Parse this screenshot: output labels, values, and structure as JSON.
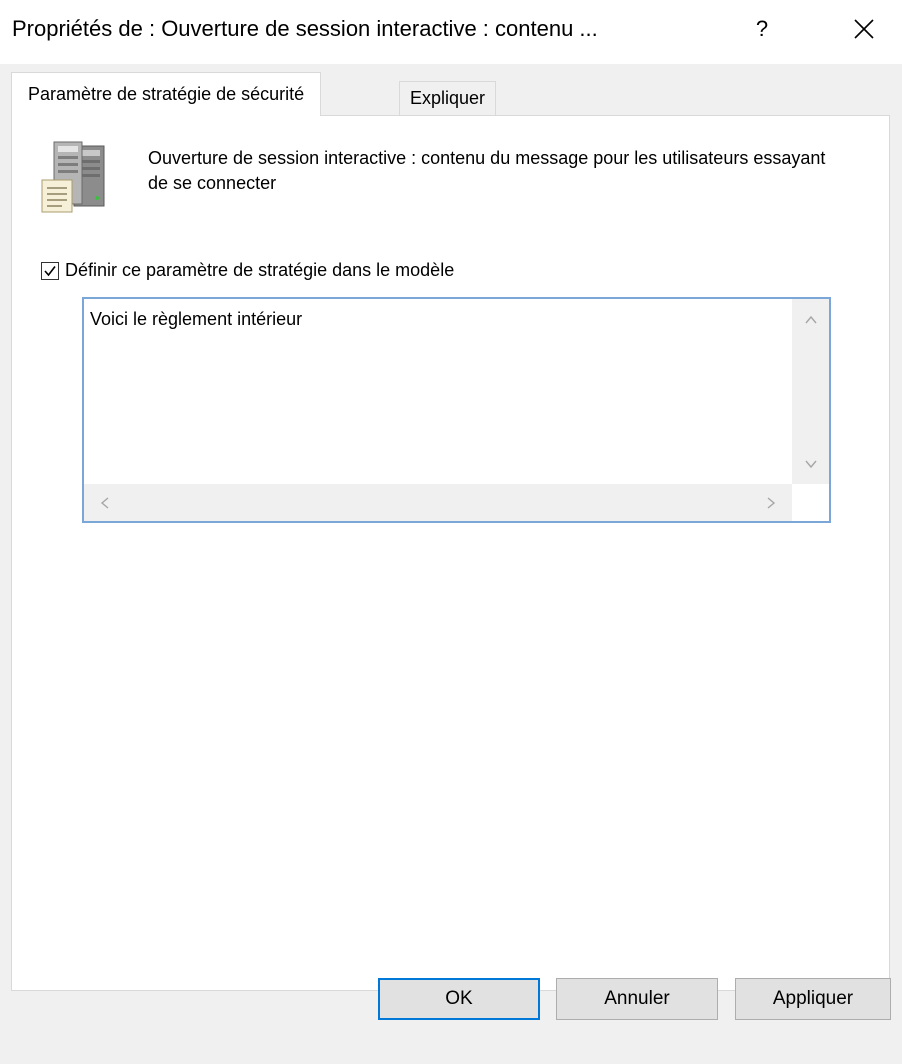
{
  "window": {
    "title": "Propriétés de : Ouverture de session interactive : contenu ...",
    "help_label": "?",
    "close_icon": "close-icon"
  },
  "tabs": [
    {
      "label": "Paramètre de stratégie de sécurité",
      "active": true
    },
    {
      "label": "Expliquer",
      "active": false
    }
  ],
  "policy": {
    "icon": "server-document-icon",
    "description": "Ouverture de session interactive : contenu du message pour les utilisateurs essayant de se connecter"
  },
  "define_setting": {
    "label": "Définir ce paramètre de stratégie dans le modèle",
    "checked": true
  },
  "message_text": {
    "value": "Voici le règlement intérieur"
  },
  "buttons": {
    "ok": "OK",
    "cancel": "Annuler",
    "apply": "Appliquer"
  },
  "colors": {
    "focus_border": "#7aa7d8",
    "default_button_border": "#0078d7",
    "dialog_background": "#f0f0f0"
  }
}
